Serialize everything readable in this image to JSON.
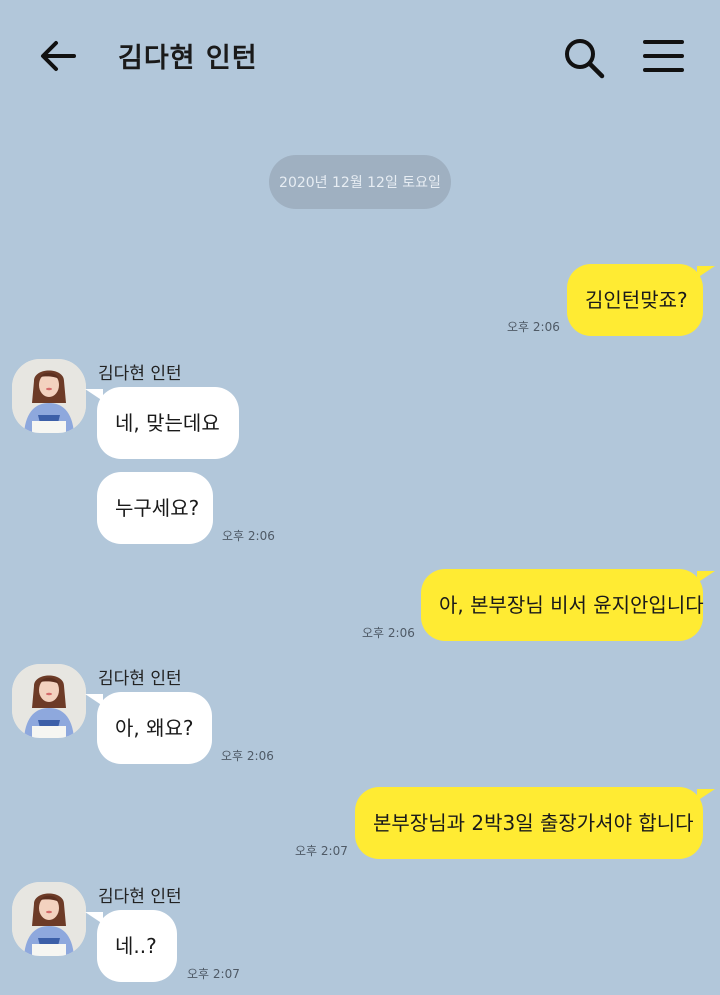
{
  "header": {
    "title": "김다현 인턴",
    "back_icon": "arrow-left-icon",
    "search_icon": "search-icon",
    "menu_icon": "hamburger-menu-icon"
  },
  "date_divider": "2020년 12월 12일 토요일",
  "contact_name": "김다현 인턴",
  "messages": [
    {
      "from": "me",
      "text": "김인턴맞죠?",
      "time": "오후 2:06"
    },
    {
      "from": "them",
      "text": "네, 맞는데요"
    },
    {
      "from": "them",
      "text": "누구세요?",
      "time": "오후 2:06"
    },
    {
      "from": "me",
      "text": "아, 본부장님 비서 윤지안입니다",
      "time": "오후 2:06"
    },
    {
      "from": "them",
      "text": "아, 왜요?",
      "time": "오후 2:06"
    },
    {
      "from": "me",
      "text": "본부장님과 2박3일 출장가셔야 합니다",
      "time": "오후 2:07"
    },
    {
      "from": "them",
      "text": "네..?",
      "time": "오후 2:07"
    }
  ],
  "colors": {
    "background": "#b2c7da",
    "my_bubble": "#ffeb33",
    "their_bubble": "#ffffff"
  }
}
